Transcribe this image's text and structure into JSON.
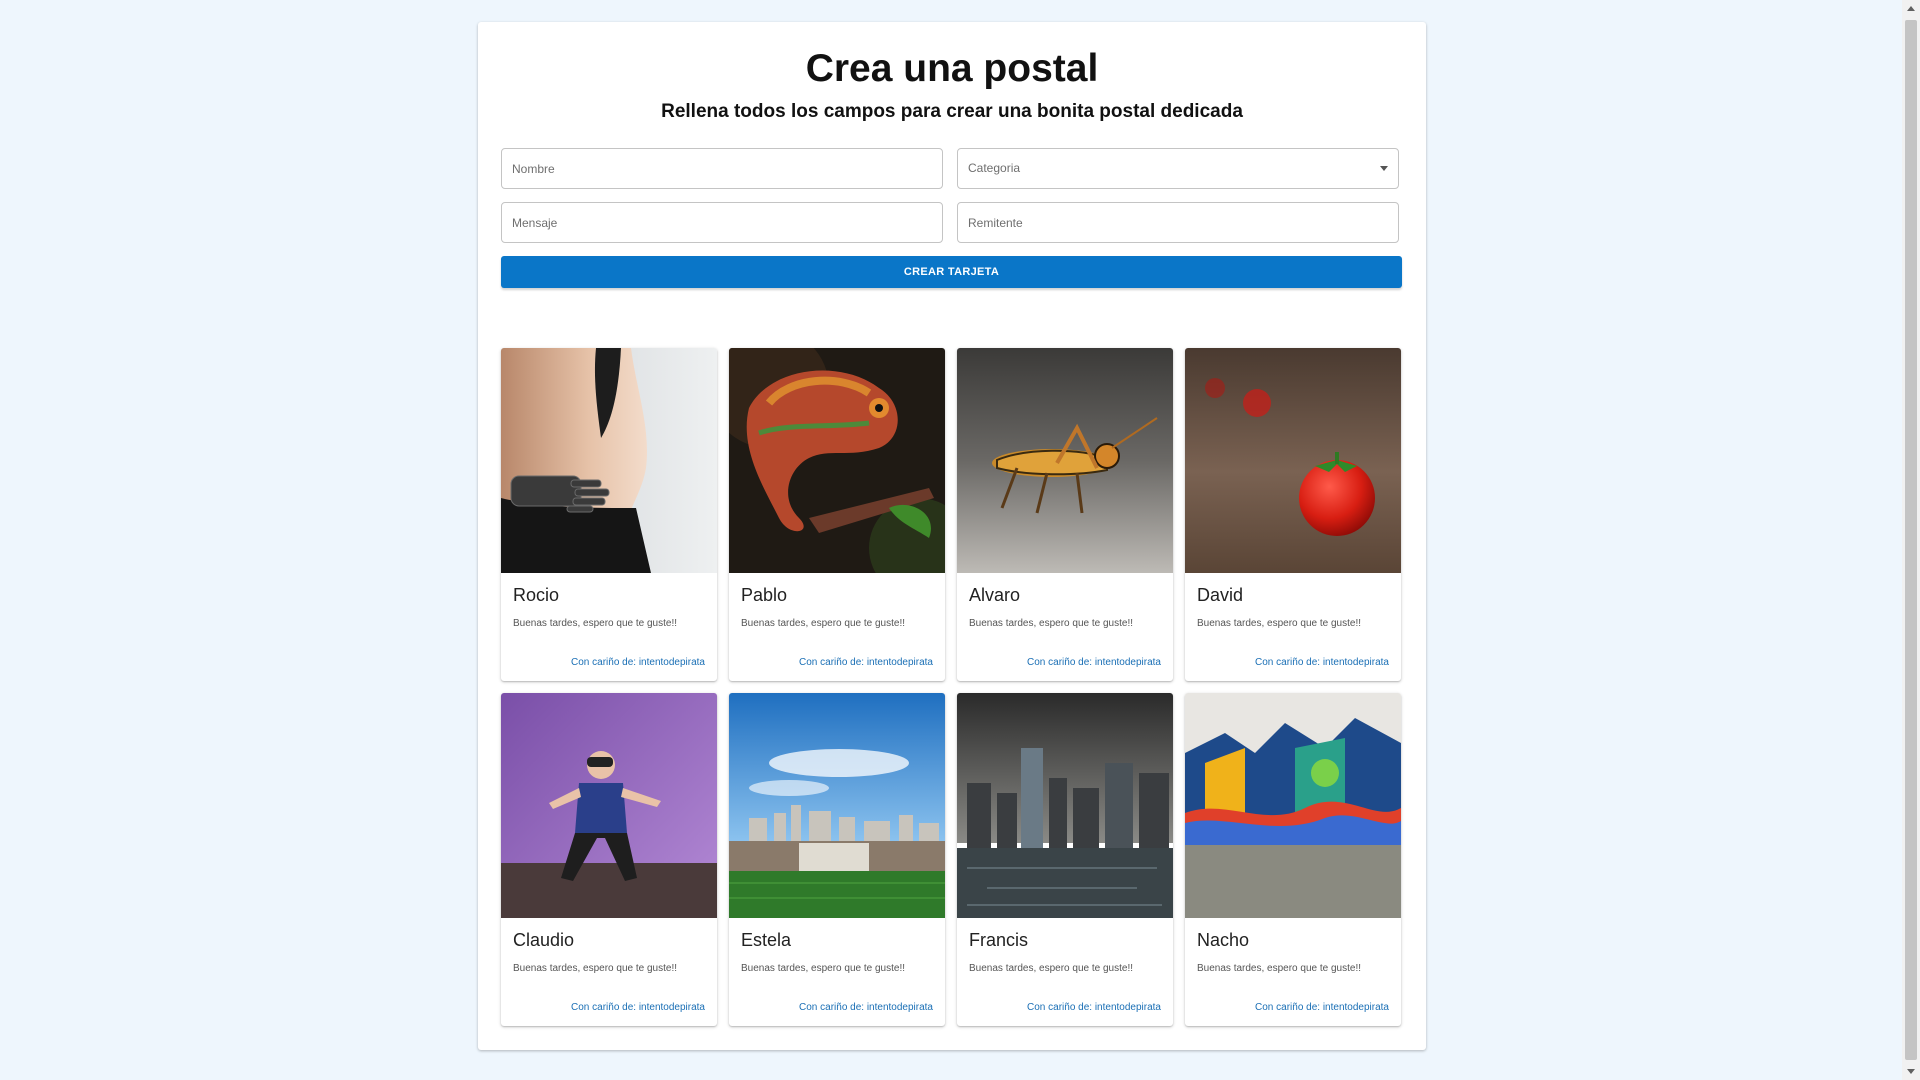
{
  "page": {
    "title": "Crea una postal",
    "subtitle": "Rellena todos los campos para crear una bonita postal dedicada"
  },
  "form": {
    "nombre_placeholder": "Nombre",
    "categoria_placeholder": "Categoria",
    "mensaje_placeholder": "Mensaje",
    "remitente_placeholder": "Remitente",
    "submit_label": "CREAR TARJETA"
  },
  "cards": [
    {
      "name": "Rocio",
      "message": "Buenas tardes, espero que te guste!!",
      "from": "Con cariño de: intentodepirata",
      "image": "prosthetic-hand-photo"
    },
    {
      "name": "Pablo",
      "message": "Buenas tardes, espero que te guste!!",
      "from": "Con cariño de: intentodepirata",
      "image": "chameleon-photo"
    },
    {
      "name": "Alvaro",
      "message": "Buenas tardes, espero que te guste!!",
      "from": "Con cariño de: intentodepirata",
      "image": "grasshopper-photo"
    },
    {
      "name": "David",
      "message": "Buenas tardes, espero que te guste!!",
      "from": "Con cariño de: intentodepirata",
      "image": "tomato-photo"
    },
    {
      "name": "Claudio",
      "message": "Buenas tardes, espero que te guste!!",
      "from": "Con cariño de: intentodepirata",
      "image": "vr-headset-person-photo"
    },
    {
      "name": "Estela",
      "message": "Buenas tardes, espero que te guste!!",
      "from": "Con cariño de: intentodepirata",
      "image": "city-skyline-park-photo"
    },
    {
      "name": "Francis",
      "message": "Buenas tardes, espero que te guste!!",
      "from": "Con cariño de: intentodepirata",
      "image": "city-river-storm-photo"
    },
    {
      "name": "Nacho",
      "message": "Buenas tardes, espero que te guste!!",
      "from": "Con cariño de: intentodepirata",
      "image": "graffiti-wall-photo"
    }
  ],
  "colors": {
    "background": "#eef6fd",
    "button": "#0a76c8",
    "link": "#1a6fb5"
  }
}
